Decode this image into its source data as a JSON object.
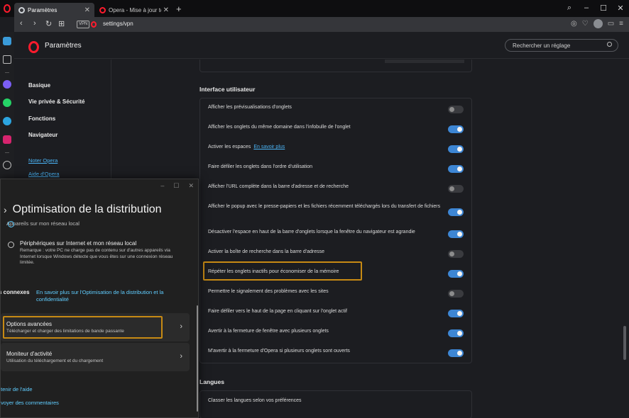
{
  "browser": {
    "tabs": [
      {
        "title": "Paramètres",
        "active": true
      },
      {
        "title": "Opera - Mise à jour termin",
        "active": false
      }
    ],
    "new_tab_label": "+",
    "nav_back": "‹",
    "nav_forward": "›",
    "nav_reload": "↻",
    "nav_tabs": "⊞",
    "vpn_badge": "VPN",
    "url": "settings/vpn",
    "window_controls": [
      "⌕",
      "–",
      "☐",
      "✕"
    ]
  },
  "settings": {
    "title": "Paramètres",
    "search_placeholder": "Rechercher un réglage",
    "nav": {
      "items": [
        "Basique",
        "Vie privée & Sécurité",
        "Fonctions",
        "Navigateur"
      ],
      "links": [
        "Noter Opera",
        "Aide d'Opera"
      ]
    },
    "ui_section": {
      "title": "Interface utilisateur",
      "rows": [
        {
          "label": "Afficher les prévisualisations d'onglets",
          "link": "",
          "on": false
        },
        {
          "label": "Afficher les onglets du même domaine dans l'infobulle de l'onglet",
          "link": "",
          "on": true
        },
        {
          "label": "Activer les espaces",
          "link": "En savoir plus",
          "on": true
        },
        {
          "label": "Faire défiler les onglets dans l'ordre d'utilisation",
          "link": "",
          "on": true
        },
        {
          "label": "Afficher l'URL complète dans la barre d'adresse et de recherche",
          "link": "",
          "on": false
        },
        {
          "label": "Afficher le popup avec le presse-papiers et les fichiers récemment téléchargés lors du transfert de fichiers",
          "link": "",
          "on": true
        },
        {
          "label": "Désactiver l'espace en haut de la barre d'onglets lorsque la fenêtre du navigateur est agrandie",
          "link": "",
          "on": true
        },
        {
          "label": "Activer la boîte de recherche dans la barre d'adresse",
          "link": "",
          "on": false
        },
        {
          "label": "Répéter les onglets inactifs pour économiser de la mémoire",
          "link": "",
          "on": true
        },
        {
          "label": "Permettre le signalement des problèmes avec les sites",
          "link": "",
          "on": false
        },
        {
          "label": "Faire défiler vers le haut de la page en cliquant sur l'onglet actif",
          "link": "",
          "on": true
        },
        {
          "label": "Avertir à la fermeture de fenêtre avec plusieurs onglets",
          "link": "",
          "on": true
        },
        {
          "label": "M'avertir à la fermeture d'Opera si plusieurs onglets sont ouverts",
          "link": "",
          "on": true
        }
      ]
    },
    "lang_section": {
      "title": "Langues",
      "row_label": "Classer les langues selon vos préférences"
    }
  },
  "dialog": {
    "controls": [
      "–",
      "☐",
      "✕"
    ],
    "back_chevron": "›",
    "title": "Optimisation de la distribution",
    "cut_text": "Appareils sur mon réseau local",
    "radio_label": "Périphériques sur Internet et mon réseau local",
    "radio_desc": "Remarque : votre PC ne charge pas de contenu sur d'autres appareils via Internet lorsque Windows détecte que vous êtes sur une connexion réseau limitée.",
    "connexes_label": "s connexes",
    "connexes_link": "En savoir plus sur l'Optimisation de la distribution et la confidentialité",
    "cards": [
      {
        "title": "Options avancées",
        "subtitle": "Télécharger et charger des limitations de bande passante",
        "arrow": "›"
      },
      {
        "title": "Moniteur d'activité",
        "subtitle": "Utilisation du téléchargement et du chargement",
        "arrow": "›"
      }
    ],
    "links": [
      "btenir de l'aide",
      "nvoyer des commentaires"
    ]
  },
  "colors": {
    "accent": "#3d86d4",
    "link": "#4ab3f4",
    "highlight": "#c78a14",
    "opera_red": "#ff1b2d"
  }
}
